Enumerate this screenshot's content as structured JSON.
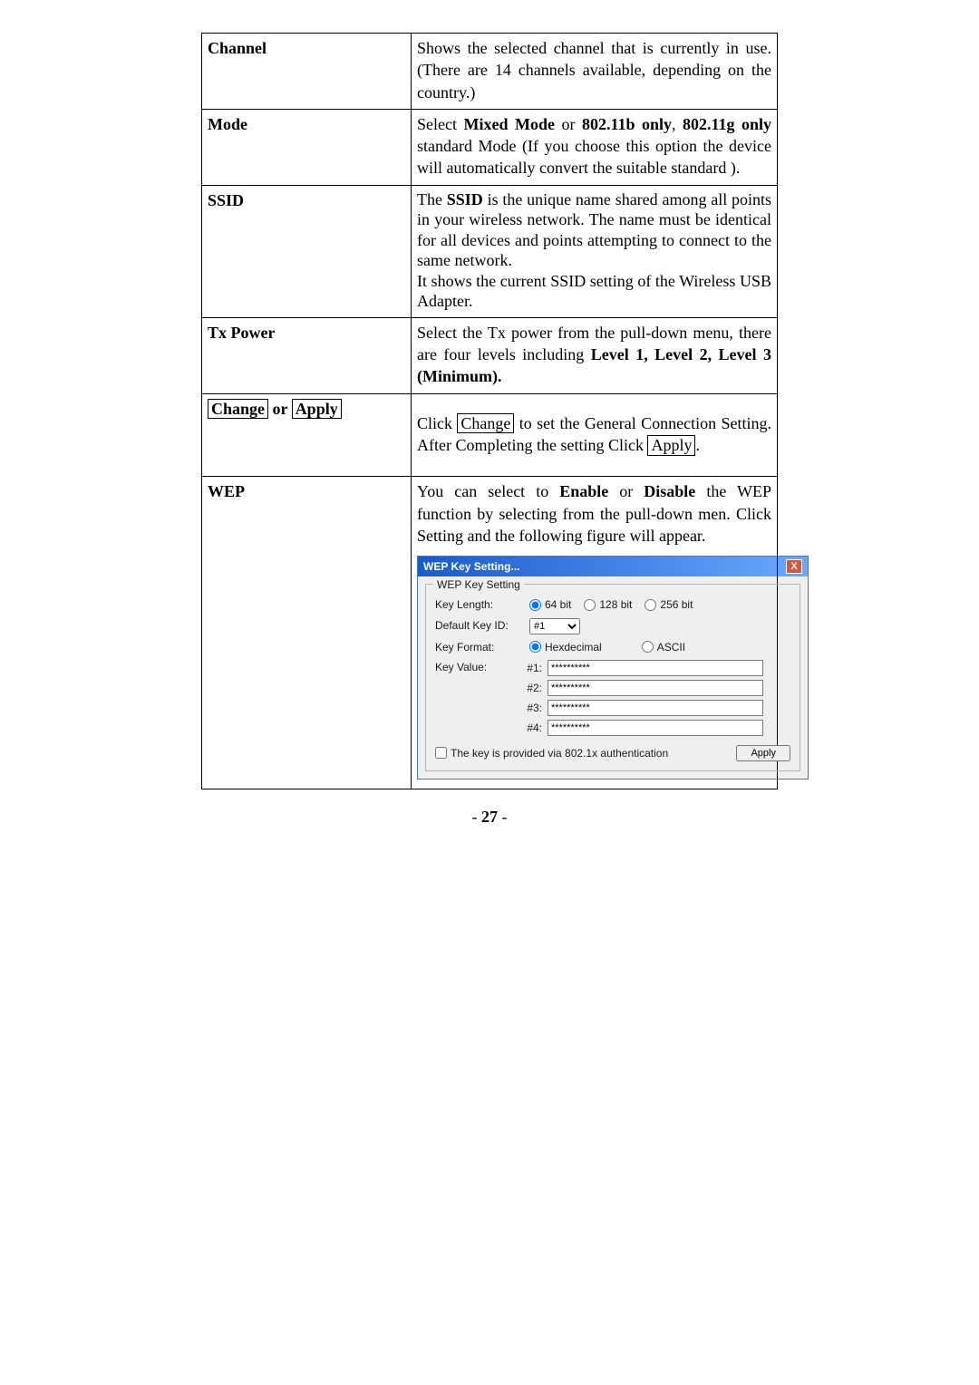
{
  "rows": {
    "channel": {
      "label": "Channel",
      "desc": "Shows the selected channel that is currently in use. (There are 14 channels available, depending on the country.)"
    },
    "mode": {
      "label": "Mode",
      "desc_pre": "Select ",
      "desc_b1": "Mixed Mode",
      "desc_mid1": " or ",
      "desc_b2": "802.11b only",
      "desc_mid2": ", ",
      "desc_b3": "802.11g only",
      "desc_post": " standard Mode (If you choose this option the device will automatically convert the suitable standard )."
    },
    "ssid": {
      "label": "SSID",
      "p1_pre": "The ",
      "p1_b": "SSID",
      "p1_post": " is the unique name shared among all points in your wireless network. The name must be identical for all devices and points attempting to connect to the same network.",
      "p2": "It shows the current SSID setting of the Wireless USB Adapter."
    },
    "txpower": {
      "label": "Tx Power",
      "desc_pre": "Select the Tx power from the pull-down menu, there are four levels including ",
      "desc_b": "Level 1, Level 2, Level 3 (Minimum)."
    },
    "change": {
      "label_a": "Change",
      "label_or": " or ",
      "label_b": "Apply",
      "d1": "Click ",
      "btn1": "Change",
      "d2": " to set the General Connection Setting. After Completing the setting Click ",
      "btn2": "Apply",
      "d3": "."
    },
    "wep": {
      "label": "WEP",
      "desc_pre": "You can select to ",
      "desc_b1": "Enable",
      "desc_mid": " or ",
      "desc_b2": "Disable",
      "desc_post": " the WEP function by selecting from the pull-down men. Click Setting and the following figure will appear."
    }
  },
  "wep_dialog": {
    "title": "WEP Key Setting...",
    "group_title": "WEP Key Setting",
    "key_length_label": "Key Length:",
    "kl_64": "64 bit",
    "kl_128": "128 bit",
    "kl_256": "256 bit",
    "default_key_label": "Default Key ID:",
    "default_key_value": "#1",
    "key_format_label": "Key Format:",
    "kf_hex": "Hexdecimal",
    "kf_ascii": "ASCII",
    "key_value_label": "Key Value:",
    "idx1": "#1:",
    "idx2": "#2:",
    "idx3": "#3:",
    "idx4": "#4:",
    "mask": "**********",
    "auth_checkbox": "The key is provided via 802.1x authentication",
    "apply": "Apply"
  },
  "page_number_prefix": "- ",
  "page_number": "27",
  "page_number_suffix": " -"
}
